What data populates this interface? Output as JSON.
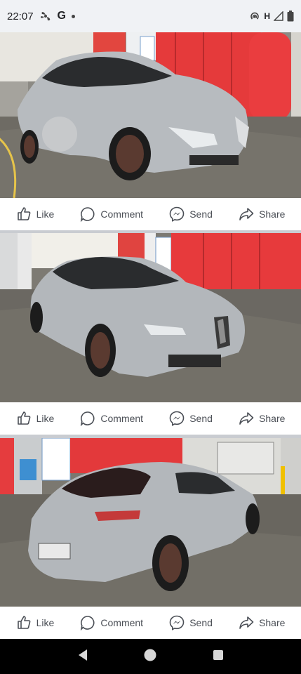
{
  "status_bar": {
    "time": "22:07",
    "g_label": "G",
    "network_label": "H",
    "icons": [
      "fan-icon",
      "g-icon",
      "dot-icon",
      "hotspot-icon",
      "signal-icon",
      "battery-icon"
    ]
  },
  "posts": [
    {
      "photo_subject": "silver-coupe-front-three-quarter",
      "actions": {
        "like": "Like",
        "comment": "Comment",
        "send": "Send",
        "share": "Share"
      }
    },
    {
      "photo_subject": "silver-coupe-front-view",
      "actions": {
        "like": "Like",
        "comment": "Comment",
        "send": "Send",
        "share": "Share"
      }
    },
    {
      "photo_subject": "silver-coupe-rear-view",
      "actions": {
        "like": "Like",
        "comment": "Comment",
        "send": "Send",
        "share": "Share"
      }
    }
  ],
  "nav_bar": {
    "icons": [
      "back-icon",
      "home-icon",
      "recents-icon"
    ]
  },
  "colors": {
    "car": "#b8bcc0",
    "wall_red": "#e63a3c",
    "floor": "#6f6c66",
    "action_text": "#4b4f56",
    "separator": "#c9ccd1"
  }
}
